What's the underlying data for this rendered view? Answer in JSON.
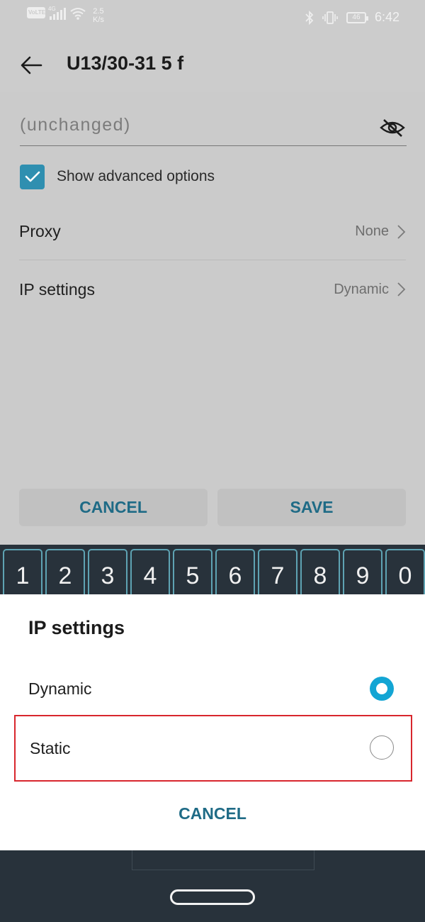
{
  "status_bar": {
    "volte": "VoLTE",
    "network": "4G",
    "speed_value": "2.5",
    "speed_unit": "K/s",
    "battery": "46",
    "time": "6:42"
  },
  "app_bar": {
    "title": "U13/30-31 5 f"
  },
  "form": {
    "password_value": "(unchanged)",
    "show_advanced_label": "Show advanced options",
    "show_advanced_checked": true,
    "proxy_label": "Proxy",
    "proxy_value": "None",
    "ip_settings_label": "IP settings",
    "ip_settings_value": "Dynamic",
    "cancel_label": "CANCEL",
    "save_label": "SAVE"
  },
  "keyboard": {
    "number_keys": [
      "1",
      "2",
      "3",
      "4",
      "5",
      "6",
      "7",
      "8",
      "9",
      "0"
    ]
  },
  "dialog": {
    "title": "IP settings",
    "options": [
      {
        "label": "Dynamic",
        "selected": true
      },
      {
        "label": "Static",
        "selected": false
      }
    ],
    "cancel_label": "CANCEL"
  },
  "colors": {
    "accent": "#13a5d4",
    "button_text": "#1f6b86",
    "highlight_box": "#d8262d",
    "keyboard_bg": "#28323b"
  }
}
